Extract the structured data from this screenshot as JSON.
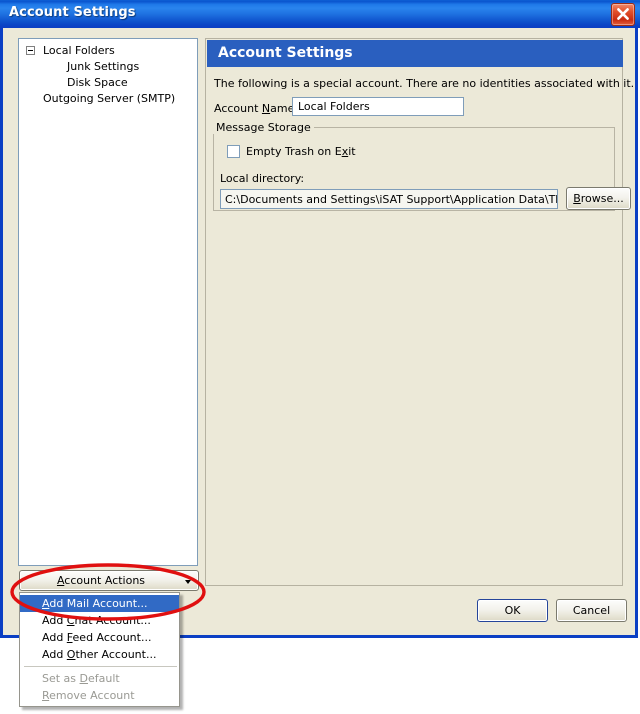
{
  "window": {
    "title": "Account Settings",
    "close_icon": "close-icon",
    "titlebar_color": "#0b3fc4",
    "face_color": "#ece9d8"
  },
  "tree": {
    "items": [
      {
        "label": "Local Folders",
        "level": 0,
        "expanded": true
      },
      {
        "label": "Junk Settings",
        "level": 1,
        "expanded": false
      },
      {
        "label": "Disk Space",
        "level": 1,
        "expanded": false
      },
      {
        "label": "Outgoing Server (SMTP)",
        "level": 0,
        "expanded": false
      }
    ]
  },
  "panel": {
    "header": "Account Settings",
    "description": "The following is a special account. There are no identities associated with it.",
    "account_name_label": "Account Name:",
    "account_name_value": "Local Folders",
    "account_name_accel": "N",
    "group": {
      "legend": "Message Storage",
      "empty_trash_label": "Empty Trash on Exit",
      "empty_trash_accel": "x",
      "empty_trash_checked": false,
      "local_directory_label": "Local directory:",
      "local_directory_value": "C:\\Documents and Settings\\iSAT Support\\Application Data\\Thunde",
      "browse_label": "Browse...",
      "browse_accel": "B"
    }
  },
  "account_actions": {
    "button_label": "Account Actions",
    "button_accel": "A",
    "arrow_icon": "chevron-down-icon",
    "menu_items": [
      {
        "label": "Add Mail Account...",
        "accel": "A",
        "state": "selected"
      },
      {
        "label": "Add Chat Account...",
        "accel": "C",
        "state": "normal"
      },
      {
        "label": "Add Feed Account...",
        "accel": "F",
        "state": "normal"
      },
      {
        "label": "Add Other Account...",
        "accel": "O",
        "state": "normal"
      },
      {
        "label": "separator",
        "state": "separator"
      },
      {
        "label": "Set as Default",
        "accel": "D",
        "state": "disabled"
      },
      {
        "label": "Remove Account",
        "accel": "R",
        "state": "disabled"
      }
    ]
  },
  "footer": {
    "ok_label": "OK",
    "cancel_label": "Cancel"
  },
  "annotation": {
    "shape": "ellipse",
    "color": "#e01010",
    "stroke_width": 3
  }
}
